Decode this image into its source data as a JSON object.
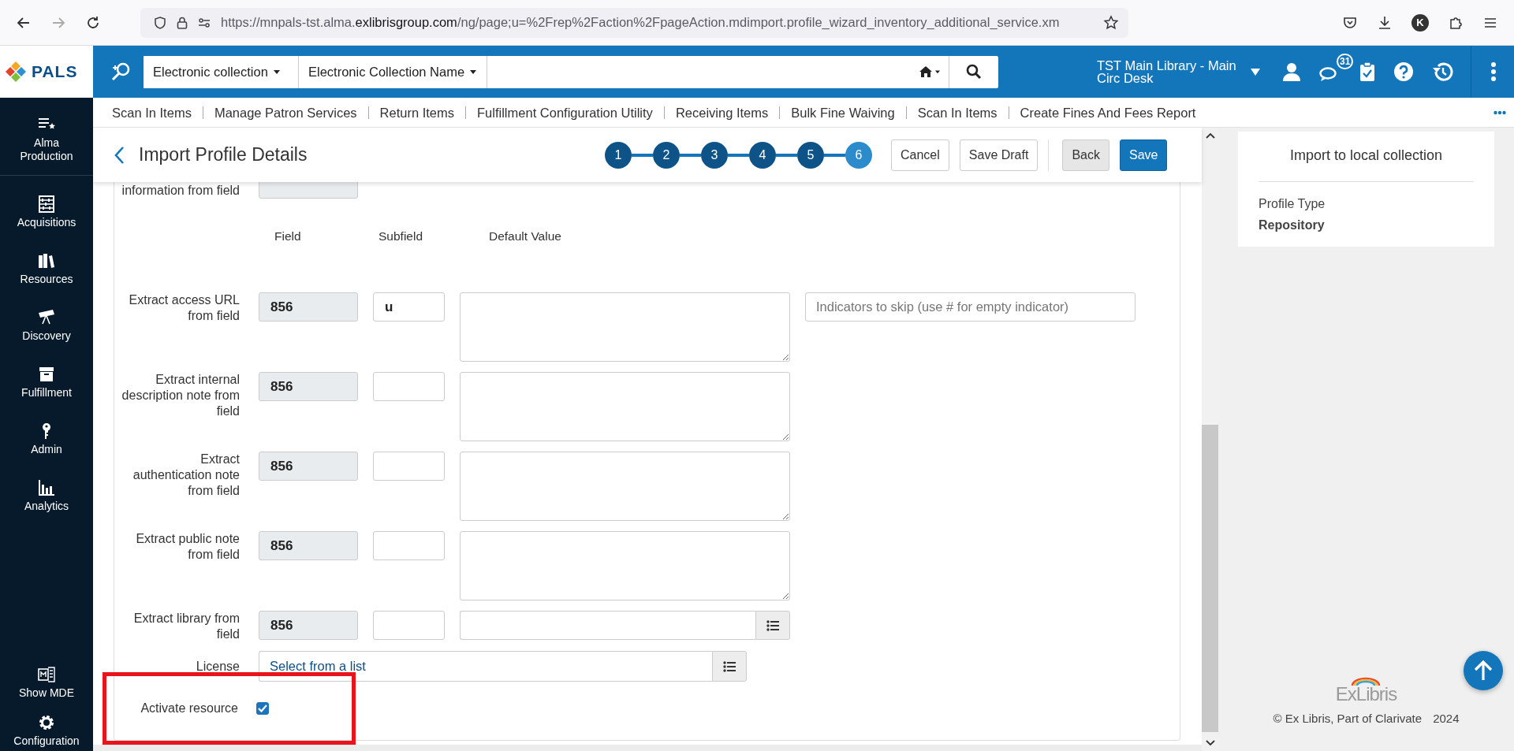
{
  "browser": {
    "url_prefix": "https://mnpals-tst.alma.",
    "url_domain": "exlibrisgroup.com",
    "url_path": "/ng/page;u=%2Frep%2Faction%2FpageAction.mdimport.profile_wizard_inventory_additional_service.xm",
    "profile_initial": "K"
  },
  "app": {
    "logo": "PALS",
    "search_scope": "Electronic collection",
    "search_field": "Electronic Collection Name",
    "location": "TST Main Library - Main Circ Desk",
    "notification_count": "31"
  },
  "sidebar": {
    "environment": {
      "label": "Alma Production",
      "kind": "alma"
    },
    "items": [
      {
        "label": "Acquisitions",
        "kind": "acquisitions"
      },
      {
        "label": "Resources",
        "kind": "resources"
      },
      {
        "label": "Discovery",
        "kind": "discovery"
      },
      {
        "label": "Fulfillment",
        "kind": "fulfillment"
      },
      {
        "label": "Admin",
        "kind": "admin"
      },
      {
        "label": "Analytics",
        "kind": "analytics"
      }
    ],
    "bottom_items": [
      {
        "label": "Show MDE",
        "kind": "mde"
      },
      {
        "label": "Configuration",
        "kind": "config"
      }
    ]
  },
  "quick_links": [
    "Scan In Items",
    "Manage Patron Services",
    "Return Items",
    "Fulfillment Configuration Utility",
    "Receiving Items",
    "Bulk Fine Waiving",
    "Scan In Items",
    "Create Fines And Fees Report"
  ],
  "page_header": {
    "title": "Import Profile Details",
    "steps": [
      {
        "label": "1",
        "selected": false
      },
      {
        "label": "2",
        "selected": false
      },
      {
        "label": "3",
        "selected": false
      },
      {
        "label": "4",
        "selected": false
      },
      {
        "label": "5",
        "selected": false
      },
      {
        "label": "6",
        "selected": true
      }
    ],
    "buttons": [
      {
        "label": "Cancel",
        "kind": "default"
      },
      {
        "label": "Save Draft",
        "kind": "default"
      },
      {
        "label": "Back",
        "kind": "muted"
      },
      {
        "label": "Save",
        "kind": "primary"
      }
    ]
  },
  "form": {
    "partial_row": {
      "label": "information from field"
    },
    "columns": [
      "Field",
      "Subfield",
      "Default Value"
    ],
    "rows": [
      {
        "label": "Extract access URL from field",
        "field": "856",
        "subfield": "u",
        "kind": "textarea",
        "indicators_placeholder": "Indicators to skip (use # for empty indicator)"
      },
      {
        "label": "Extract internal description note from field",
        "field": "856",
        "kind": "textarea"
      },
      {
        "label": "Extract authentication note from field",
        "field": "856",
        "kind": "textarea"
      },
      {
        "label": "Extract public note from field",
        "field": "856",
        "kind": "textarea"
      },
      {
        "label": "Extract library from field",
        "field": "856",
        "kind": "list"
      }
    ],
    "license": {
      "label": "License",
      "placeholder": "Select from a list"
    },
    "activate": {
      "label": "Activate resource",
      "checked": true
    }
  },
  "summary": {
    "title": "Import to local collection",
    "profile_type_label": "Profile Type",
    "profile_type": "Repository"
  },
  "footer": {
    "logo": "ExLibris",
    "copyright": "© Ex Libris, Part of Clarivate",
    "year": "2024"
  }
}
